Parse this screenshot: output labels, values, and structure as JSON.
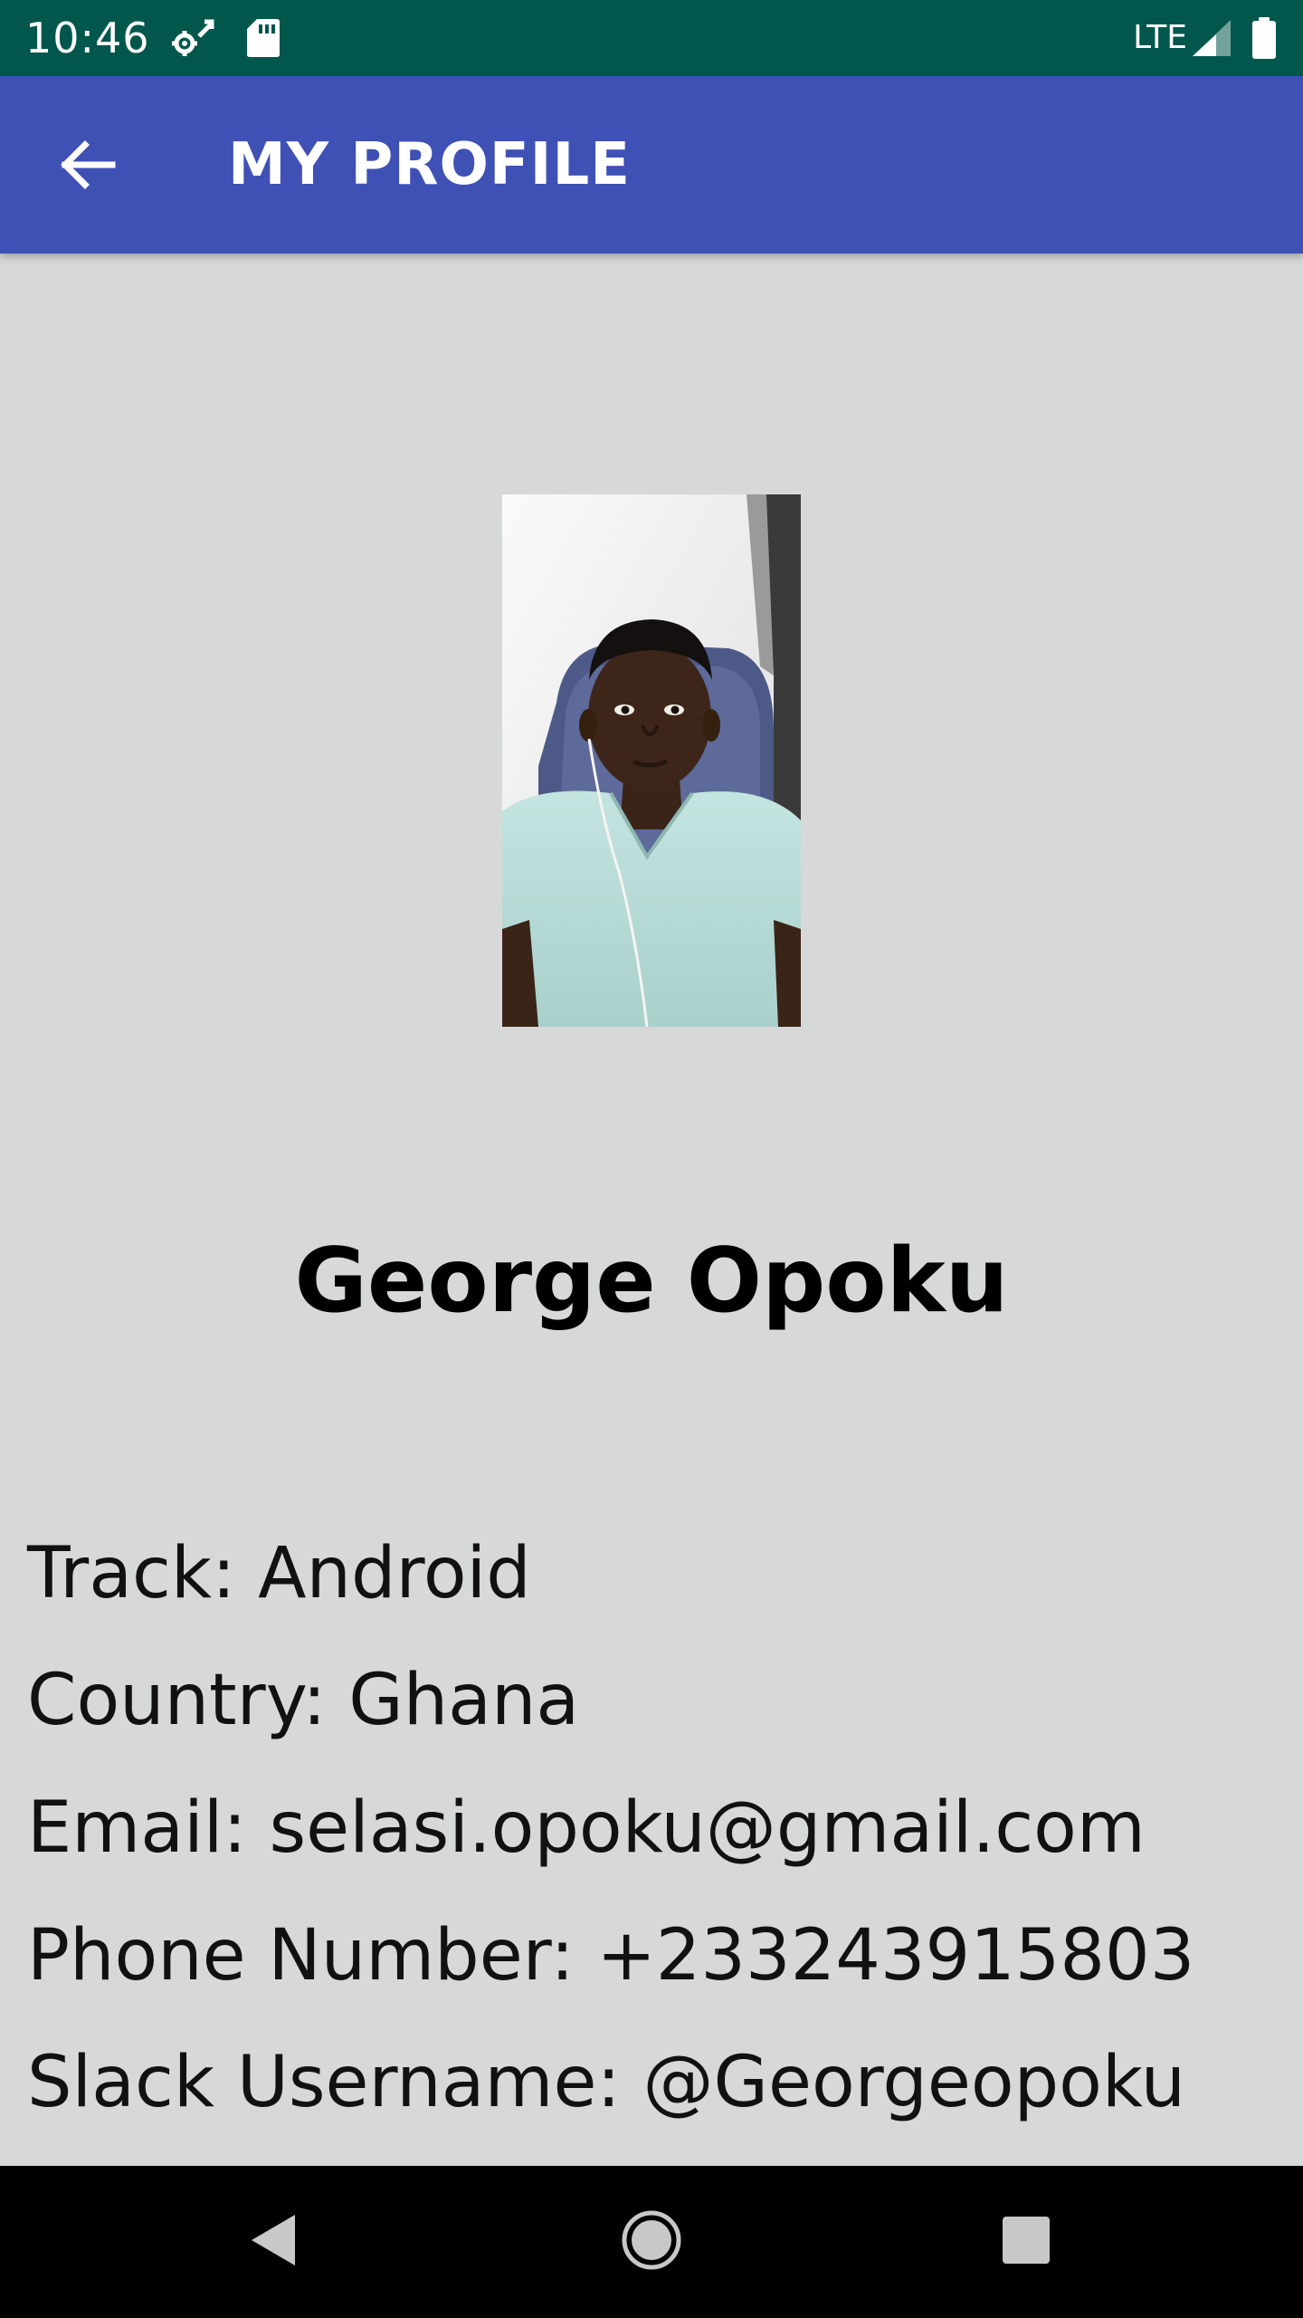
{
  "status_bar": {
    "time": "10:46",
    "network": "LTE",
    "icons": [
      "settings-sync-icon",
      "sd-card-icon",
      "signal-icon",
      "battery-icon"
    ]
  },
  "app_bar": {
    "title": "MY PROFILE",
    "back_icon": "arrow-back-icon"
  },
  "profile": {
    "name": "George Opoku",
    "track": "Track: Android",
    "country": "Country: Ghana",
    "email": "Email: selasi.opoku@gmail.com",
    "phone": "Phone Number: +233243915803",
    "slack": "Slack Username: @Georgeopoku"
  },
  "nav_bar": {
    "icons": [
      "back-triangle-icon",
      "home-circle-icon",
      "recents-square-icon"
    ]
  },
  "colors": {
    "status_bar": "#01574c",
    "app_bar": "#3f51b5",
    "background": "#d7d8d8",
    "nav_bar": "#000000"
  }
}
